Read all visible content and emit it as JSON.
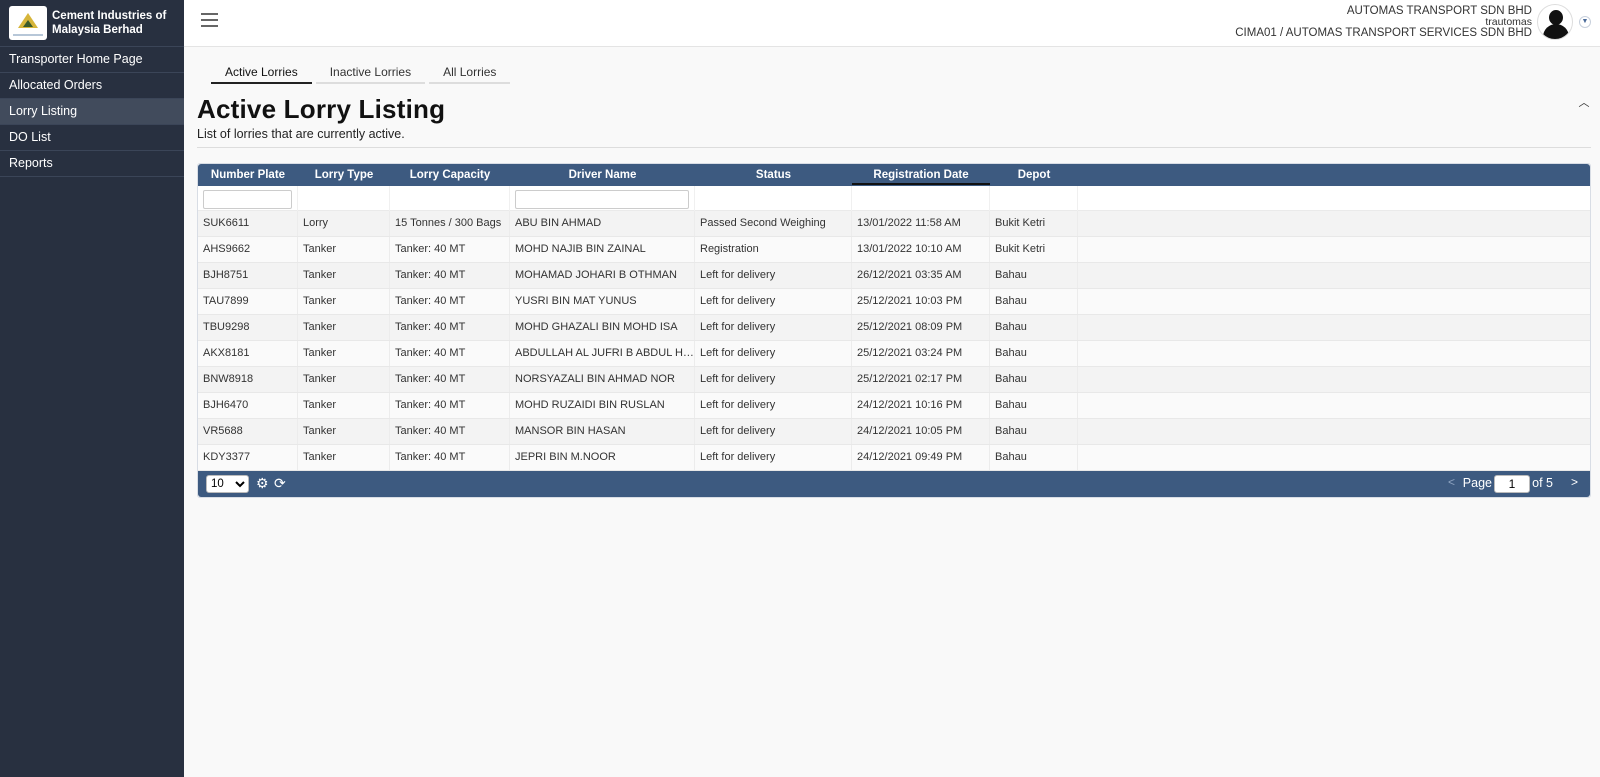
{
  "brand": {
    "name": "Cement Industries of Malaysia Berhad",
    "logo_icon": "cima-logo-icon"
  },
  "sidebar": {
    "items": [
      {
        "label": "Transporter Home Page",
        "active": false
      },
      {
        "label": "Allocated Orders",
        "active": false
      },
      {
        "label": "Lorry Listing",
        "active": true
      },
      {
        "label": "DO List",
        "active": false
      },
      {
        "label": "Reports",
        "active": false
      }
    ]
  },
  "topbar": {
    "menu_icon": "hamburger-icon",
    "company": "AUTOMAS TRANSPORT SDN BHD",
    "login": "trautomas",
    "account": "CIMA01 / AUTOMAS TRANSPORT SERVICES SDN BHD",
    "avatar_icon": "user-avatar-icon"
  },
  "tabs": [
    {
      "label": "Active Lorries",
      "active": true
    },
    {
      "label": "Inactive Lorries",
      "active": false
    },
    {
      "label": "All Lorries",
      "active": false
    }
  ],
  "page": {
    "title": "Active Lorry Listing",
    "subtitle": "List of lorries that are currently active."
  },
  "table": {
    "columns": [
      "Number Plate",
      "Lorry Type",
      "Lorry Capacity",
      "Driver Name",
      "Status",
      "Registration Date",
      "Depot"
    ],
    "sorted_column": "Registration Date",
    "rows": [
      [
        "SUK6611",
        "Lorry",
        "15 Tonnes / 300 Bags",
        "ABU BIN AHMAD",
        "Passed Second Weighing",
        "13/01/2022 11:58 AM",
        "Bukit Ketri"
      ],
      [
        "AHS9662",
        "Tanker",
        "Tanker: 40 MT",
        "MOHD NAJIB BIN ZAINAL",
        "Registration",
        "13/01/2022 10:10 AM",
        "Bukit Ketri"
      ],
      [
        "BJH8751",
        "Tanker",
        "Tanker: 40 MT",
        "MOHAMAD JOHARI B OTHMAN",
        "Left for delivery",
        "26/12/2021 03:35 AM",
        "Bahau"
      ],
      [
        "TAU7899",
        "Tanker",
        "Tanker: 40 MT",
        "YUSRI BIN MAT YUNUS",
        "Left for delivery",
        "25/12/2021 10:03 PM",
        "Bahau"
      ],
      [
        "TBU9298",
        "Tanker",
        "Tanker: 40 MT",
        "MOHD GHAZALI BIN MOHD ISA",
        "Left for delivery",
        "25/12/2021 08:09 PM",
        "Bahau"
      ],
      [
        "AKX8181",
        "Tanker",
        "Tanker: 40 MT",
        "ABDULLAH AL JUFRI B ABDUL HA...",
        "Left for delivery",
        "25/12/2021 03:24 PM",
        "Bahau"
      ],
      [
        "BNW8918",
        "Tanker",
        "Tanker: 40 MT",
        "NORSYAZALI BIN AHMAD NOR",
        "Left for delivery",
        "25/12/2021 02:17 PM",
        "Bahau"
      ],
      [
        "BJH6470",
        "Tanker",
        "Tanker: 40 MT",
        "MOHD RUZAIDI BIN RUSLAN",
        "Left for delivery",
        "24/12/2021 10:16 PM",
        "Bahau"
      ],
      [
        "VR5688",
        "Tanker",
        "Tanker: 40 MT",
        "MANSOR BIN HASAN",
        "Left for delivery",
        "24/12/2021 10:05 PM",
        "Bahau"
      ],
      [
        "KDY3377",
        "Tanker",
        "Tanker: 40 MT",
        "JEPRI BIN M.NOOR",
        "Left for delivery",
        "24/12/2021 09:49 PM",
        "Bahau"
      ]
    ]
  },
  "pager": {
    "page_size": "10",
    "page_size_options": [
      "10"
    ],
    "settings_icon": "gear-icon",
    "refresh_icon": "refresh-icon",
    "prev": "<",
    "page_label": "Page",
    "current_page": "1",
    "of_label": "of 5",
    "next": ">"
  },
  "colors": {
    "sidebar": "#283040",
    "grid_header": "#3d5a80",
    "active_nav": "#414b5c"
  }
}
